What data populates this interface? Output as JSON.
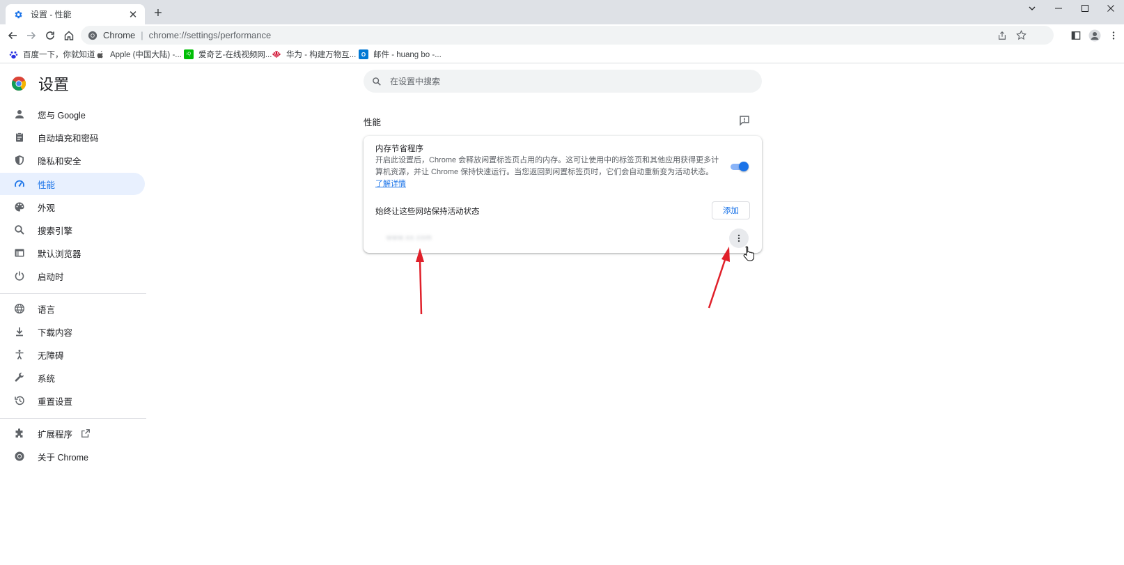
{
  "browser": {
    "tab": {
      "title": "设置 - 性能",
      "favicon": "gear-icon"
    },
    "omnibox": {
      "site_label": "Chrome",
      "separator": "|",
      "url": "chrome://settings/performance"
    },
    "bookmarks": [
      {
        "label": "百度一下，你就知道",
        "icon": "baidu-paw-icon",
        "color": "#2932e1"
      },
      {
        "label": "Apple (中国大陆) -...",
        "icon": "apple-icon",
        "color": "#555555"
      },
      {
        "label": "爱奇艺-在线视频网...",
        "icon": "iqiyi-icon",
        "color": "#00be06"
      },
      {
        "label": "华为 - 构建万物互...",
        "icon": "huawei-icon",
        "color": "#cf0a2c"
      },
      {
        "label": "邮件 - huang bo -...",
        "icon": "outlook-icon",
        "color": "#0078d4"
      }
    ]
  },
  "settings": {
    "title": "设置",
    "search_placeholder": "在设置中搜索",
    "nav": [
      {
        "label": "您与 Google",
        "icon": "person-icon"
      },
      {
        "label": "自动填充和密码",
        "icon": "clipboard-icon"
      },
      {
        "label": "隐私和安全",
        "icon": "shield-icon"
      },
      {
        "label": "性能",
        "icon": "speedometer-icon",
        "active": true
      },
      {
        "label": "外观",
        "icon": "palette-icon"
      },
      {
        "label": "搜索引擎",
        "icon": "search-icon"
      },
      {
        "label": "默认浏览器",
        "icon": "browser-window-icon"
      },
      {
        "label": "启动时",
        "icon": "power-icon"
      },
      {
        "label": "语言",
        "icon": "globe-icon"
      },
      {
        "label": "下载内容",
        "icon": "download-icon"
      },
      {
        "label": "无障碍",
        "icon": "accessibility-icon"
      },
      {
        "label": "系统",
        "icon": "wrench-icon"
      },
      {
        "label": "重置设置",
        "icon": "history-icon"
      },
      {
        "label": "扩展程序",
        "icon": "puzzle-icon"
      },
      {
        "label": "关于 Chrome",
        "icon": "chrome-logo-icon"
      }
    ],
    "section_title": "性能",
    "memory_saver": {
      "title": "内存节省程序",
      "description": "开启此设置后，Chrome 会释放闲置标签页占用的内存。这可让使用中的标签页和其他应用获得更多计算机资源，并让 Chrome 保持快速运行。当您返回到闲置标签页时，它们会自动重新变为活动状态。",
      "learn_more": "了解详情",
      "enabled": true,
      "always_active_label": "始终让这些网站保持活动状态",
      "add_button": "添加",
      "site_entry": "www.xx.com"
    }
  },
  "colors": {
    "accent": "#1a73e8",
    "annotation_arrow": "#e0202a"
  }
}
